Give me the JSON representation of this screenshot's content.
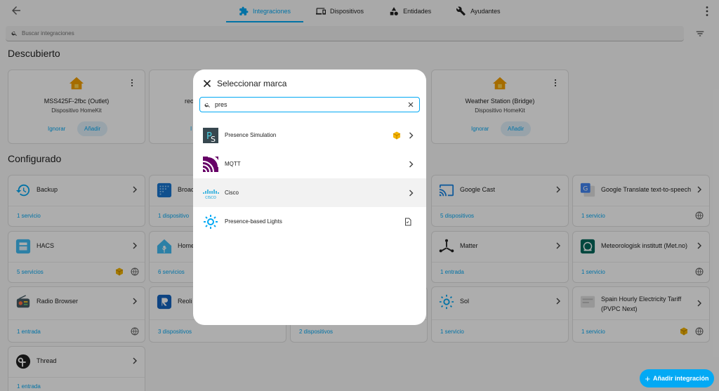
{
  "tabs": [
    {
      "label": "Integraciones",
      "icon": "puzzle-icon",
      "active": true
    },
    {
      "label": "Dispositivos",
      "icon": "devices-icon",
      "active": false
    },
    {
      "label": "Entidades",
      "icon": "shapes-icon",
      "active": false
    },
    {
      "label": "Ayudantes",
      "icon": "tools-icon",
      "active": false
    }
  ],
  "search": {
    "placeholder": "Buscar integraciones"
  },
  "discovered": {
    "title": "Descubierto",
    "cards": [
      {
        "name": "MSS425F-2fbc (Outlet)",
        "subtitle": "Dispositivo HomeKit",
        "ignore": "Ignorar",
        "add": "Añadir"
      },
      {
        "name": "reo",
        "subtitle": "",
        "ignore": "I",
        "add": ""
      },
      {
        "name": "Weather Station (Bridge)",
        "subtitle": "Dispositivo HomeKit",
        "ignore": "Ignorar",
        "add": "Añadir"
      }
    ]
  },
  "configured": {
    "title": "Configurado",
    "items": [
      {
        "name": "Backup",
        "count": "1 servicio"
      },
      {
        "name": "Broad",
        "count": "1 dispositivo"
      },
      {
        "name": "Google Cast",
        "count": "5 dispositivos"
      },
      {
        "name": "Google Translate text-to-speech",
        "count": "1 servicio"
      },
      {
        "name": "HACS",
        "count": "5 servicios"
      },
      {
        "name": "Home",
        "count": "6 servicios"
      },
      {
        "name": "Matter",
        "count": "1 entrada"
      },
      {
        "name": "Meteorologisk institutt (Met.no)",
        "count": "1 servicio"
      },
      {
        "name": "Radio Browser",
        "count": "1 entrada"
      },
      {
        "name": "Reoli",
        "count": "3 dispositivos"
      },
      {
        "name": "",
        "count": "2 dispositivos"
      },
      {
        "name": "Sol",
        "count": "1 servicio"
      },
      {
        "name": "Spain Hourly Electricity Tariff (PVPC Next)",
        "count": "1 servicio"
      },
      {
        "name": "Thread",
        "count": "1 entrada"
      }
    ]
  },
  "fab": {
    "label": "Añadir integración"
  },
  "dialog": {
    "title": "Seleccionar marca",
    "search_value": "pres",
    "brands": [
      {
        "name": "Presence Simulation",
        "mark": "custom-package-icon"
      },
      {
        "name": "MQTT",
        "mark": ""
      },
      {
        "name": "Cisco",
        "mark": ""
      },
      {
        "name": "Presence-based Lights",
        "mark": "blueprint-icon"
      }
    ]
  },
  "colors": {
    "accent": "#03a9f4",
    "custom_badge": "#f4b400",
    "mqtt": "#660066"
  }
}
